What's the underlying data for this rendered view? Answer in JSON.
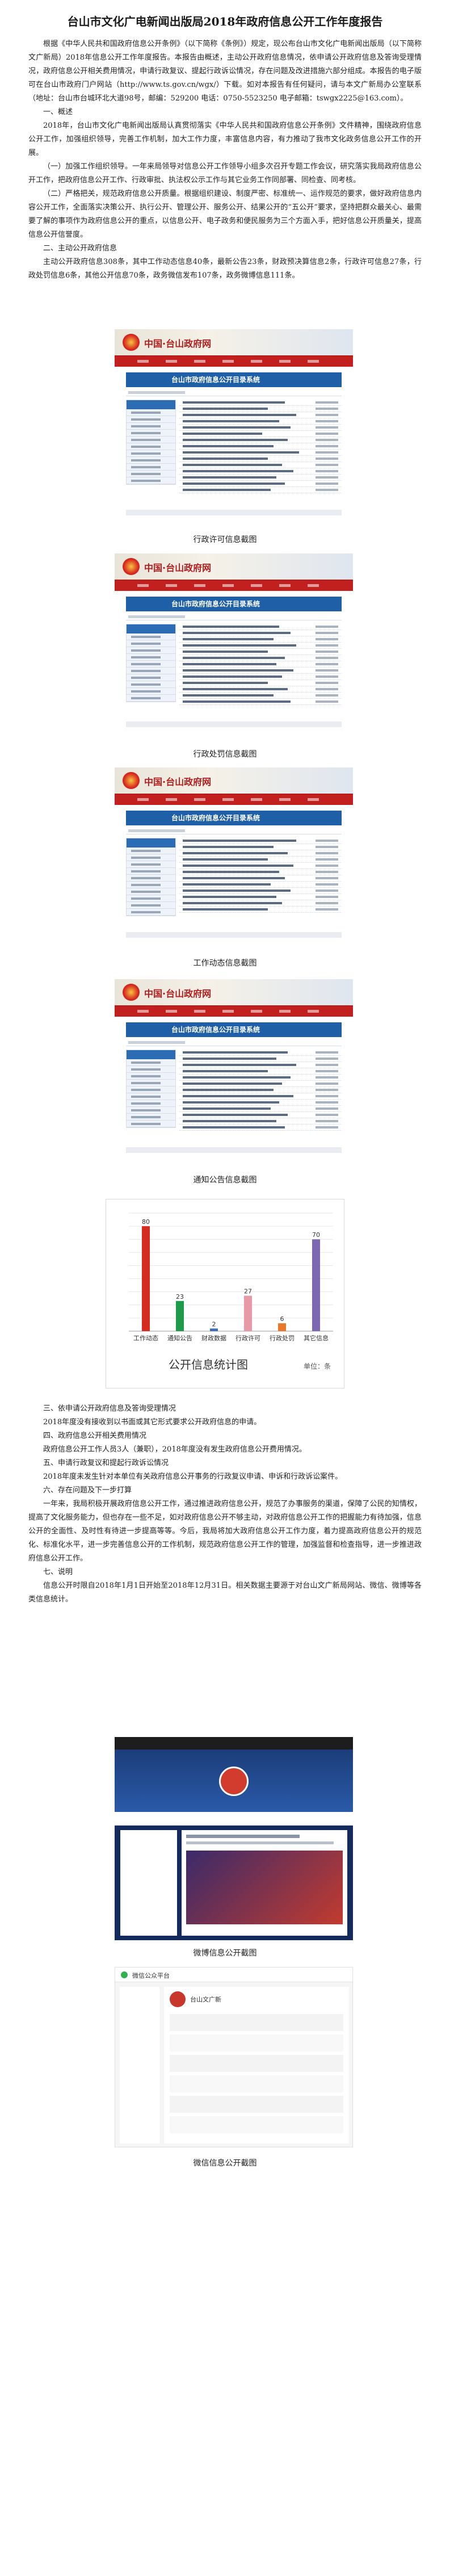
{
  "title": "台山市文化广电新闻出版局2018年政府信息公开工作年度报告",
  "intro": "根据《中华人民共和国政府信息公开条例》（以下简称《条例》）规定，现公布台山市文化广电新闻出版局（以下简称文广新局）2018年信息公开工作年度报告。本报告由概述，主动公开政府信息情况，依申请公开政府信息及答询受理情况，政府信息公开相关费用情况，申请行政复议、提起行政诉讼情况，存在问题及改进措施六部分组成。本报告的电子版可在台山市政府门户网站（http://www.ts.gov.cn/wgx/）下载。如对本报告有任何疑问，请与本文广新局办公室联系（地址：台山市台城环北大道98号，邮编：529200 电话：0750-5523250 电子邮箱：tswgx2225@163.com）。",
  "h1": "一、概述",
  "p1": "2018年，台山市文化广电新闻出版局认真贯彻落实《中华人民共和国政府信息公开条例》文件精神，围绕政府信息公开工作，加强组织领导，完善工作机制，加大工作力度，丰富信息内容，有力推动了我市文化政务信息公开工作的开展。",
  "p2": "（一）加强工作组织领导。一年来局领导对信息公开工作领导小组多次召开专题工作会议，研究落实我局政府信息公开工作，把政府信息公开工作、行政审批、执法权公示工作与其它业务工作同部署、同检查、同考核。",
  "p3": "（二）严格把关，规范政府信息公开质量。根据组织建设、制度严密、标准统一、运作规范的要求，做好政府信息内容公开工作，全面落实决策公开、执行公开、管理公开、服务公开、结果公开的“五公开”要求，坚持把群众最关心、最需要了解的事项作为政府信息公开的重点，以信息公开、电子政务和便民服务为三个方面入手，把好信息公开质量关，提高信息公开信誉度。",
  "h2": "二、主动公开政府信息",
  "p4": "主动公开政府信息308条，其中工作动态信息40条，最新公告23条，财政预决算信息2条，行政许可信息27条，行政处罚信息6条，其他公开信息70条，政务微信发布107条，政务微博信息111条。",
  "captions": {
    "shot1": "行政许可信息截图",
    "shot2": "行政处罚信息截图",
    "shot3": "工作动态信息截图",
    "shot4": "通知公告信息截图",
    "weibo": "微博信息公开截图",
    "weixin": "微信信息公开截图"
  },
  "portal": {
    "logo": "中国·台山政府网",
    "system_title": "台山市政府信息公开目录系统"
  },
  "chart_data": {
    "type": "bar",
    "title": "公开信息统计图",
    "unit_label": "单位：条",
    "categories": [
      "工作动态",
      "通知公告",
      "财政数据",
      "行政许可",
      "行政处罚",
      "其它信息"
    ],
    "values": [
      80,
      23,
      2,
      27,
      6,
      70
    ],
    "colors": [
      "#d62b1f",
      "#1e9a4b",
      "#3a6fb5",
      "#e79aa6",
      "#e8792b",
      "#7e67b1"
    ],
    "ylim": [
      0,
      90
    ]
  },
  "h3": "三、依申请公开政府信息及答询受理情况",
  "p5": "2018年度没有接收到以书面或其它形式要求公开政府信息的申请。",
  "h4": "四、政府信息公开相关费用情况",
  "p6": "政府信息公开工作人员3人（兼职），2018年度没有发生政府信息公开费用情况。",
  "h5": "五、申请行政复议和提起行政诉讼情况",
  "p7": "2018年度未发生针对本单位有关政府信息公开事务的行政复议申请、申诉和行政诉讼案件。",
  "h6": "六、存在问题及下一步打算",
  "p8": "一年来，我局积极开展政府信息公开工作，通过推进政府信息公开，规范了办事服务的渠道，保障了公民的知情权，提高了文化服务能力，但也存在一些不足，如对政府信息公开不够主动，对政府信息公开工作的把握能力有待加强，信息公开的全面性、及时性有待进一步提高等等。今后，我局将加大政府信息公开工作力度，着力提高政府信息公开的规范化、标准化水平，进一步完善信息公开的工作机制，规范政府信息公开工作的管理，加强监督和检查指导，进一步推进政府信息公开工作。",
  "h7": "七、说明",
  "p9": "信息公开时限自2018年1月1日开始至2018年12月31日。相关数据主要源于对台山文广新局网站、微信、微博等各类信息统计。",
  "weixin_ui": {
    "account": "台山文广新",
    "nav": "微信公众平台"
  }
}
